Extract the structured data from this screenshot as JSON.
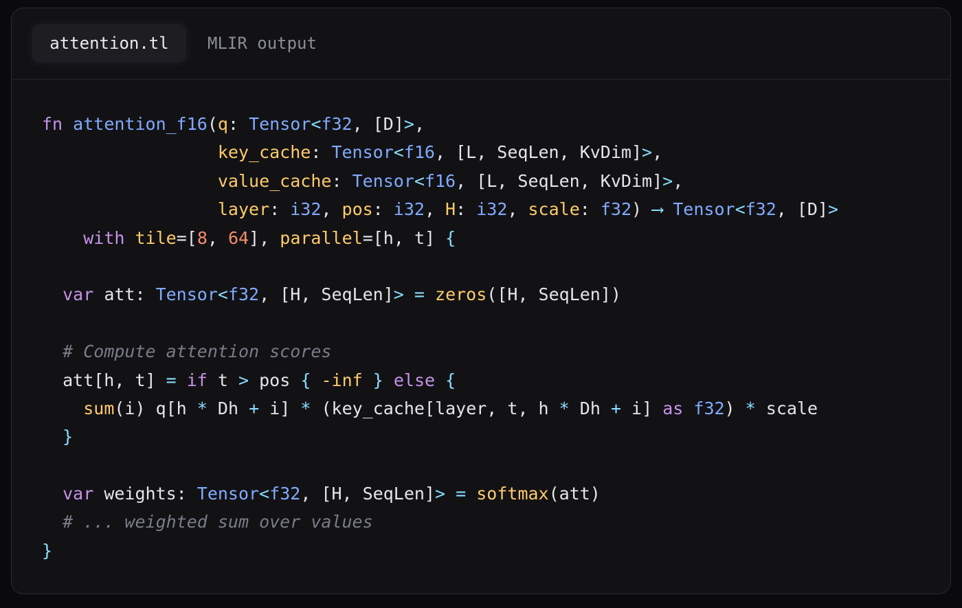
{
  "tabs": [
    {
      "label": "attention.tl",
      "active": true
    },
    {
      "label": "MLIR output",
      "active": false
    }
  ],
  "colors": {
    "background": "#121215",
    "keyword": "#c792ea",
    "function": "#82aaff",
    "type": "#82aaff",
    "parameter": "#ffcb6b",
    "operator": "#89ddff",
    "number": "#f78c6c",
    "comment": "#7a7d89",
    "text": "#e6e6ea"
  },
  "code": {
    "language": "tl",
    "lines": [
      [
        [
          "fn",
          "kw"
        ],
        [
          " ",
          "plain"
        ],
        [
          "attention_f16",
          "fn"
        ],
        [
          "(",
          "plain"
        ],
        [
          "q",
          "param"
        ],
        [
          ": ",
          "plain"
        ],
        [
          "Tensor",
          "type"
        ],
        [
          "<",
          "op"
        ],
        [
          "f32",
          "type"
        ],
        [
          ", [D]",
          "plain"
        ],
        [
          ">",
          "op"
        ],
        [
          ",",
          "plain"
        ]
      ],
      [
        [
          "                 ",
          "plain"
        ],
        [
          "key_cache",
          "param"
        ],
        [
          ": ",
          "plain"
        ],
        [
          "Tensor",
          "type"
        ],
        [
          "<",
          "op"
        ],
        [
          "f16",
          "type"
        ],
        [
          ", [L, SeqLen, KvDim]",
          "plain"
        ],
        [
          ">",
          "op"
        ],
        [
          ",",
          "plain"
        ]
      ],
      [
        [
          "                 ",
          "plain"
        ],
        [
          "value_cache",
          "param"
        ],
        [
          ": ",
          "plain"
        ],
        [
          "Tensor",
          "type"
        ],
        [
          "<",
          "op"
        ],
        [
          "f16",
          "type"
        ],
        [
          ", [L, SeqLen, KvDim]",
          "plain"
        ],
        [
          ">",
          "op"
        ],
        [
          ",",
          "plain"
        ]
      ],
      [
        [
          "                 ",
          "plain"
        ],
        [
          "layer",
          "param"
        ],
        [
          ": ",
          "plain"
        ],
        [
          "i32",
          "type"
        ],
        [
          ", ",
          "plain"
        ],
        [
          "pos",
          "param"
        ],
        [
          ": ",
          "plain"
        ],
        [
          "i32",
          "type"
        ],
        [
          ", ",
          "plain"
        ],
        [
          "H",
          "param"
        ],
        [
          ": ",
          "plain"
        ],
        [
          "i32",
          "type"
        ],
        [
          ", ",
          "plain"
        ],
        [
          "scale",
          "param"
        ],
        [
          ": ",
          "plain"
        ],
        [
          "f32",
          "type"
        ],
        [
          ") ",
          "plain"
        ],
        [
          "⟶",
          "op"
        ],
        [
          " ",
          "plain"
        ],
        [
          "Tensor",
          "type"
        ],
        [
          "<",
          "op"
        ],
        [
          "f32",
          "type"
        ],
        [
          ", [D]",
          "plain"
        ],
        [
          ">",
          "op"
        ]
      ],
      [
        [
          "    ",
          "plain"
        ],
        [
          "with",
          "kw"
        ],
        [
          " ",
          "plain"
        ],
        [
          "tile",
          "param"
        ],
        [
          "=[",
          "plain"
        ],
        [
          "8",
          "num"
        ],
        [
          ", ",
          "plain"
        ],
        [
          "64",
          "num"
        ],
        [
          "], ",
          "plain"
        ],
        [
          "parallel",
          "param"
        ],
        [
          "=[h, t] ",
          "plain"
        ],
        [
          "{",
          "op"
        ]
      ],
      [],
      [
        [
          "  ",
          "plain"
        ],
        [
          "var",
          "kw"
        ],
        [
          " att: ",
          "plain"
        ],
        [
          "Tensor",
          "type"
        ],
        [
          "<",
          "op"
        ],
        [
          "f32",
          "type"
        ],
        [
          ", [H, SeqLen]",
          "plain"
        ],
        [
          ">",
          "op"
        ],
        [
          " ",
          "plain"
        ],
        [
          "=",
          "op"
        ],
        [
          " ",
          "plain"
        ],
        [
          "zeros",
          "call"
        ],
        [
          "([H, SeqLen])",
          "plain"
        ]
      ],
      [],
      [
        [
          "  ",
          "plain"
        ],
        [
          "# Compute attention scores",
          "comment"
        ]
      ],
      [
        [
          "  att[h, t] ",
          "plain"
        ],
        [
          "=",
          "op"
        ],
        [
          " ",
          "plain"
        ],
        [
          "if",
          "kw"
        ],
        [
          " t ",
          "plain"
        ],
        [
          ">",
          "op"
        ],
        [
          " pos ",
          "plain"
        ],
        [
          "{",
          "op"
        ],
        [
          " ",
          "plain"
        ],
        [
          "-inf",
          "param"
        ],
        [
          " ",
          "plain"
        ],
        [
          "}",
          "op"
        ],
        [
          " ",
          "plain"
        ],
        [
          "else",
          "kw"
        ],
        [
          " ",
          "plain"
        ],
        [
          "{",
          "op"
        ]
      ],
      [
        [
          "    ",
          "plain"
        ],
        [
          "sum",
          "call"
        ],
        [
          "(i) q[h ",
          "plain"
        ],
        [
          "*",
          "op"
        ],
        [
          " Dh ",
          "plain"
        ],
        [
          "+",
          "op"
        ],
        [
          " i] ",
          "plain"
        ],
        [
          "*",
          "op"
        ],
        [
          " (key_cache[layer, t, h ",
          "plain"
        ],
        [
          "*",
          "op"
        ],
        [
          " Dh ",
          "plain"
        ],
        [
          "+",
          "op"
        ],
        [
          " i] ",
          "plain"
        ],
        [
          "as",
          "kw"
        ],
        [
          " ",
          "plain"
        ],
        [
          "f32",
          "type"
        ],
        [
          ") ",
          "plain"
        ],
        [
          "*",
          "op"
        ],
        [
          " scale",
          "plain"
        ]
      ],
      [
        [
          "  ",
          "plain"
        ],
        [
          "}",
          "op"
        ]
      ],
      [],
      [
        [
          "  ",
          "plain"
        ],
        [
          "var",
          "kw"
        ],
        [
          " weights: ",
          "plain"
        ],
        [
          "Tensor",
          "type"
        ],
        [
          "<",
          "op"
        ],
        [
          "f32",
          "type"
        ],
        [
          ", [H, SeqLen]",
          "plain"
        ],
        [
          ">",
          "op"
        ],
        [
          " ",
          "plain"
        ],
        [
          "=",
          "op"
        ],
        [
          " ",
          "plain"
        ],
        [
          "softmax",
          "call"
        ],
        [
          "(att)",
          "plain"
        ]
      ],
      [
        [
          "  ",
          "plain"
        ],
        [
          "# ... weighted sum over values",
          "comment"
        ]
      ],
      [
        [
          "}",
          "op"
        ]
      ]
    ]
  }
}
